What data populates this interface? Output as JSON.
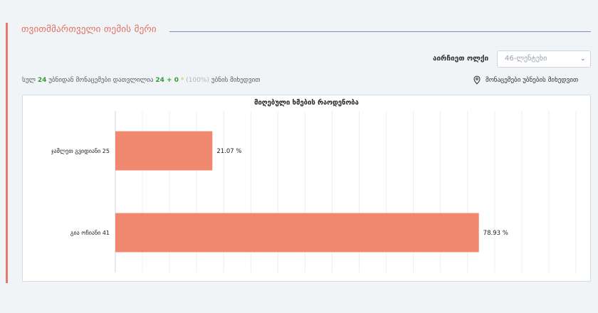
{
  "header": {
    "title": "თვითმმართველი თემის მერი"
  },
  "filter": {
    "label": "აირჩიეთ ოლქი",
    "selected": "46-ლენტეხი"
  },
  "summary": {
    "prefix": "სულ",
    "total": "24",
    "mid": "უბნიდან მონაცემები დათვლილია",
    "counted": "24 + 0",
    "star": "*",
    "percent": "(100%)",
    "suffix": "უბნის მიხედვით"
  },
  "station_link": {
    "label": "მონაცემები უბნების მიხედვით",
    "icon": "map-pin-icon"
  },
  "colors": {
    "accent": "#e47b6a",
    "bar": "#f0876f",
    "green": "#2e9e3a"
  },
  "chart_data": {
    "type": "bar",
    "orientation": "horizontal",
    "title": "მიღებული ხმების რაოდენობა",
    "categories": [
      "ჯამლეთ გვიდიანი 25",
      "გია ოჩიანი 41"
    ],
    "values": [
      21.07,
      78.93
    ],
    "value_labels": [
      "21.07 %",
      "78.93 %"
    ],
    "xlim": [
      0,
      100
    ],
    "grid": "vertical"
  }
}
